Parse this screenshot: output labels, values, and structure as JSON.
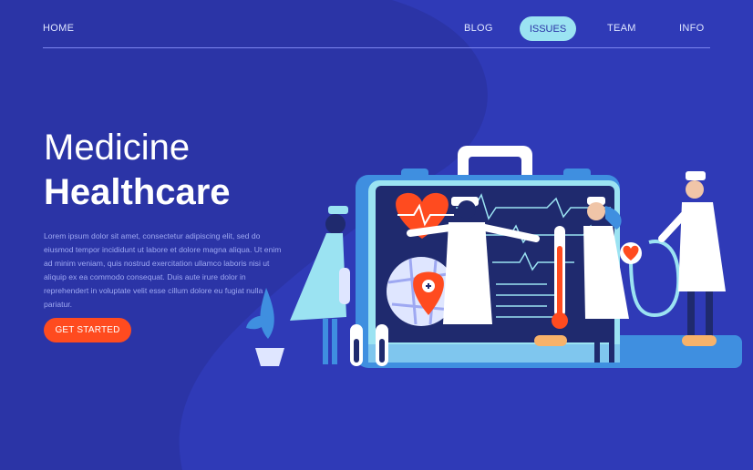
{
  "nav": {
    "home": "HOME",
    "blog": "BLOG",
    "issues": "ISSUES",
    "team": "TEAM",
    "info": "INFO"
  },
  "hero": {
    "title_line1": "Medicine",
    "title_line2": "Healthcare",
    "body": "Lorem ipsum dolor sit amet, consectetur adipiscing elit, sed do eiusmod tempor incididunt ut labore et dolore magna aliqua. Ut enim ad minim veniam, quis nostrud exercitation ullamco laboris nisi ut aliquip ex ea commodo consequat. Duis aute irure dolor in reprehendert in voluptate velit esse cillum dolore eu fugiat nulla pariatur.",
    "cta_label": "GET STARTED"
  },
  "colors": {
    "background": "#2b34a6",
    "accent_cyan": "#9be3f2",
    "cta_orange": "#ff4b1f",
    "heart_red": "#ff4b1f"
  },
  "illustration": {
    "icons": [
      "medical-case",
      "heart-pulse-icon",
      "map-pin-icon",
      "thermometer-icon",
      "stethoscope-icon",
      "test-tube-icon",
      "plant-icon"
    ]
  }
}
